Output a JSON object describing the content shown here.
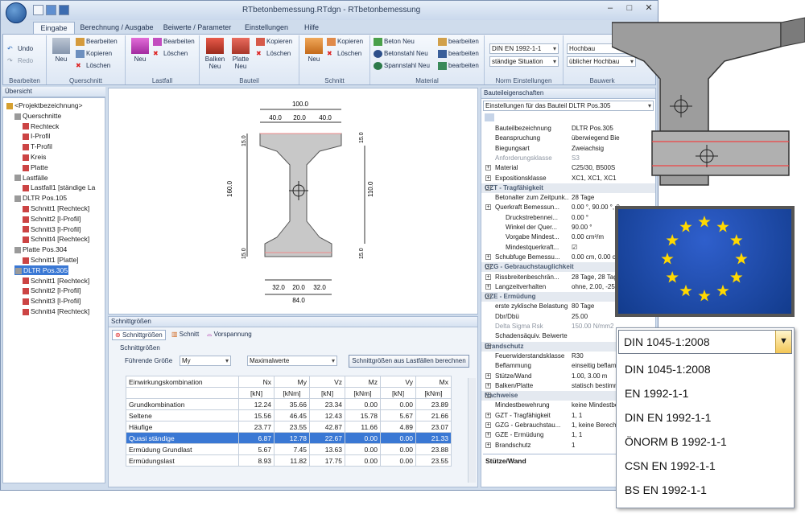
{
  "window": {
    "title": "RTbetonbemessung.RTdgn - RTbetonbemessung"
  },
  "tabs": [
    "Eingabe",
    "Berechnung / Ausgabe",
    "Beiwerte / Parameter",
    "Einstellungen",
    "Hilfe"
  ],
  "ribbon": {
    "bearbeiten": {
      "undo": "Undo",
      "redo": "Redo",
      "label": "Bearbeiten"
    },
    "querschnitt": {
      "neu": "Neu",
      "bearbeiten": "Bearbeiten",
      "kopieren": "Kopieren",
      "loeschen": "Löschen",
      "label": "Querschnitt"
    },
    "lastfall": {
      "neu": "Neu",
      "bearbeiten": "Bearbeiten",
      "loeschen": "Löschen",
      "label": "Lastfall"
    },
    "bauteil": {
      "balken": "Balken",
      "balken2": "Neu",
      "platte": "Platte",
      "platte2": "Neu",
      "kopieren": "Kopieren",
      "loeschen": "Löschen",
      "label": "Bauteil"
    },
    "schnitt": {
      "neu": "Neu",
      "kopieren": "Kopieren",
      "loeschen": "Löschen",
      "label": "Schnitt"
    },
    "material": {
      "beton": "Beton Neu",
      "betonstahl": "Betonstahl Neu",
      "spannstahl": "Spannstahl Neu",
      "b1": "bearbeiten",
      "b2": "bearbeiten",
      "b3": "bearbeiten",
      "label": "Material"
    },
    "norm": {
      "norm": "DIN EN 1992-1-1",
      "situation": "ständige Situation",
      "label": "Norm Einstellungen"
    },
    "bauwerk": {
      "typ": "Hochbau",
      "hoch": "üblicher Hochbau",
      "label": "Bauwerk"
    }
  },
  "overview": {
    "title": "Übersicht",
    "nodes": [
      {
        "t": "<Projektbezeichnung>",
        "lvl": 0
      },
      {
        "t": "Querschnitte",
        "lvl": 1
      },
      {
        "t": "Rechteck",
        "lvl": 2
      },
      {
        "t": "I-Profil",
        "lvl": 2
      },
      {
        "t": "T-Profil",
        "lvl": 2
      },
      {
        "t": "Kreis",
        "lvl": 2
      },
      {
        "t": "Platte",
        "lvl": 2
      },
      {
        "t": "Lastfälle",
        "lvl": 1
      },
      {
        "t": "Lastfall1 [ständige La",
        "lvl": 2
      },
      {
        "t": "DLTR Pos.105",
        "lvl": 1
      },
      {
        "t": "Schnitt1 [Rechteck]",
        "lvl": 2
      },
      {
        "t": "Schnitt2 [I-Profil]",
        "lvl": 2
      },
      {
        "t": "Schnitt3 [I-Profil]",
        "lvl": 2
      },
      {
        "t": "Schnitt4 [Rechteck]",
        "lvl": 2
      },
      {
        "t": "Platte Pos.304",
        "lvl": 1
      },
      {
        "t": "Schnitt1 [Platte]",
        "lvl": 2
      },
      {
        "t": "DLTR Pos.305",
        "lvl": 1,
        "sel": true
      },
      {
        "t": "Schnitt1 [Rechteck]",
        "lvl": 2
      },
      {
        "t": "Schnitt2 [I-Profil]",
        "lvl": 2
      },
      {
        "t": "Schnitt3 [I-Profil]",
        "lvl": 2
      },
      {
        "t": "Schnitt4 [Rechteck]",
        "lvl": 2
      }
    ]
  },
  "drawing": {
    "w_top": "100.0",
    "w_parts": [
      "40.0",
      "20.0",
      "40.0"
    ],
    "h_total": "160.0",
    "h_web": "110.0",
    "h_top": "15.0",
    "h_top2": "15.0",
    "h_bot": "15.0",
    "h_bot2": "15.0",
    "b_parts": [
      "32.0",
      "20.0",
      "32.0"
    ],
    "w_bot": "84.0"
  },
  "schnitt": {
    "title": "Schnittgrößen",
    "tabs": [
      "Schnittgrößen",
      "Schnitt",
      "Vorspannung"
    ],
    "group": "Schnittgrößen",
    "fuehrend": "Führende Größe",
    "f_val": "My",
    "max_val": "Maximalwerte",
    "button": "Schnittgrößen aus Lastfällen berechnen",
    "headers": [
      "Einwirkungskombination",
      "Nx",
      "My",
      "Vz",
      "Mz",
      "Vy",
      "Mx"
    ],
    "units": [
      "[kN]",
      "[kNm]",
      "[kN]",
      "[kNm]",
      "[kN]",
      "[kNm]"
    ],
    "rows": [
      {
        "n": "Grundkombination",
        "v": [
          "12.24",
          "35.66",
          "23.34",
          "0.00",
          "0.00",
          "23.89"
        ]
      },
      {
        "n": "Seltene",
        "v": [
          "15.56",
          "46.45",
          "12.43",
          "15.78",
          "5.67",
          "21.66"
        ]
      },
      {
        "n": "Häufige",
        "v": [
          "23.77",
          "23.55",
          "42.87",
          "11.66",
          "4.89",
          "23.07"
        ]
      },
      {
        "n": "Quasi ständige",
        "v": [
          "6.87",
          "12.78",
          "22.67",
          "0.00",
          "0.00",
          "21.33"
        ],
        "sel": true
      },
      {
        "n": "Ermüdung Grundlast",
        "v": [
          "5.67",
          "7.45",
          "13.63",
          "0.00",
          "0.00",
          "23.88"
        ]
      },
      {
        "n": "Ermüdungslast",
        "v": [
          "8.93",
          "11.82",
          "17.75",
          "0.00",
          "0.00",
          "23.55"
        ]
      }
    ]
  },
  "props": {
    "title": "Bauteileigenschaften",
    "select": "Einstellungen für das Bauteil DLTR Pos.305",
    "footer": "Stütze/Wand",
    "rows": [
      {
        "k": "Bauteilbezeichnung",
        "v": "DLTR Pos.305"
      },
      {
        "k": "Beanspruchung",
        "v": "überwiegend Bie"
      },
      {
        "k": "Biegungsart",
        "v": "Zweiachsig"
      },
      {
        "k": "Anforderungsklasse",
        "v": "S3",
        "gray": true
      },
      {
        "k": "Material",
        "v": "C25/30, B500S",
        "exp": true
      },
      {
        "k": "Expositionsklasse",
        "v": "XC1, XC1, XC1",
        "exp": true
      },
      {
        "k": "GZT - Tragfähigkeit",
        "cat": true
      },
      {
        "k": "Betonalter zum Zeitpunk...",
        "v": "28 Tage"
      },
      {
        "k": "Querkraft Bemessun...",
        "v": "0.00 °, 90.00 °, 0",
        "exp": true
      },
      {
        "k": "Druckstrebennei...",
        "v": "0.00 °",
        "ind": true
      },
      {
        "k": "Winkel der Quer...",
        "v": "90.00 °",
        "ind": true
      },
      {
        "k": "Vorgabe Mindest...",
        "v": "0.00 cm²/m",
        "ind": true
      },
      {
        "k": "Mindestquerkraft...",
        "v": "☑",
        "ind": true
      },
      {
        "k": "Schubfuge Bemessu...",
        "v": "0.00 cm, 0.00 cm",
        "exp": true
      },
      {
        "k": "GZG - Gebrauchstauglichkeit",
        "cat": true
      },
      {
        "k": "Rissbreitenbeschrän...",
        "v": "28 Tage, 28 Tag",
        "exp": true
      },
      {
        "k": "Langzeitverhalten",
        "v": "ohne, 2.00, -25.",
        "exp": true
      },
      {
        "k": "GZE - Ermüdung",
        "cat": true
      },
      {
        "k": "erste zyklische Belastung",
        "v": "80 Tage"
      },
      {
        "k": "Dbr/Dbü",
        "v": "25.00"
      },
      {
        "k": "Delta Sigma Rsk",
        "v": "150.00 N/mm2",
        "gray": true
      },
      {
        "k": "Schadensäquiv. Beiwerte",
        "v": ""
      },
      {
        "k": "Brandschutz",
        "cat": true
      },
      {
        "k": "Feuerwiderstandsklasse",
        "v": "R30"
      },
      {
        "k": "Beflammung",
        "v": "einseitig beflamm"
      },
      {
        "k": "Stütze/Wand",
        "v": "1.00, 3.00 m",
        "exp": true
      },
      {
        "k": "Balken/Platte",
        "v": "statisch bestimmt",
        "exp": true
      },
      {
        "k": "Nachweise",
        "cat": true
      },
      {
        "k": "Mindestbewehrung",
        "v": "keine Mindestbe"
      },
      {
        "k": "GZT - Tragfähigkeit",
        "v": "1, 1",
        "exp": true
      },
      {
        "k": "GZG - Gebrauchstau...",
        "v": "1, keine Berech",
        "exp": true
      },
      {
        "k": "GZE - Ermüdung",
        "v": "1, 1",
        "exp": true
      },
      {
        "k": "Brandschutz",
        "v": "1",
        "exp": true
      }
    ]
  },
  "dropdown": {
    "selected": "DIN 1045-1:2008",
    "items": [
      "DIN 1045-1:2008",
      "EN 1992-1-1",
      "DIN EN 1992-1-1",
      "ÖNORM B 1992-1-1",
      "CSN EN 1992-1-1",
      "BS EN 1992-1-1"
    ]
  },
  "colors": {
    "accent": "#3a78d4",
    "eu_blue": "#1b3f9a",
    "star": "#ffd800"
  }
}
